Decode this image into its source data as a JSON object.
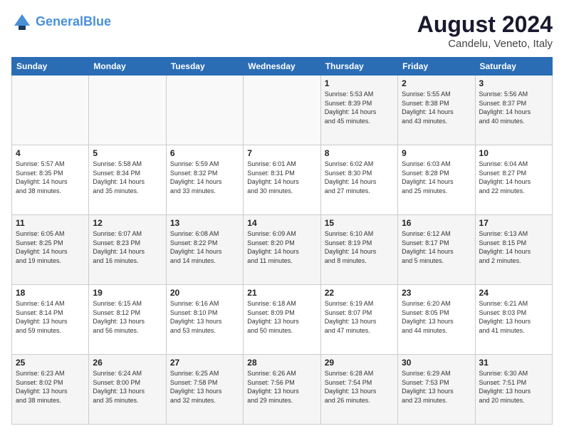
{
  "header": {
    "logo_line1": "General",
    "logo_line2": "Blue",
    "month_year": "August 2024",
    "location": "Candelu, Veneto, Italy"
  },
  "days_of_week": [
    "Sunday",
    "Monday",
    "Tuesday",
    "Wednesday",
    "Thursday",
    "Friday",
    "Saturday"
  ],
  "weeks": [
    [
      {
        "day": "",
        "info": ""
      },
      {
        "day": "",
        "info": ""
      },
      {
        "day": "",
        "info": ""
      },
      {
        "day": "",
        "info": ""
      },
      {
        "day": "1",
        "info": "Sunrise: 5:53 AM\nSunset: 8:39 PM\nDaylight: 14 hours\nand 45 minutes."
      },
      {
        "day": "2",
        "info": "Sunrise: 5:55 AM\nSunset: 8:38 PM\nDaylight: 14 hours\nand 43 minutes."
      },
      {
        "day": "3",
        "info": "Sunrise: 5:56 AM\nSunset: 8:37 PM\nDaylight: 14 hours\nand 40 minutes."
      }
    ],
    [
      {
        "day": "4",
        "info": "Sunrise: 5:57 AM\nSunset: 8:35 PM\nDaylight: 14 hours\nand 38 minutes."
      },
      {
        "day": "5",
        "info": "Sunrise: 5:58 AM\nSunset: 8:34 PM\nDaylight: 14 hours\nand 35 minutes."
      },
      {
        "day": "6",
        "info": "Sunrise: 5:59 AM\nSunset: 8:32 PM\nDaylight: 14 hours\nand 33 minutes."
      },
      {
        "day": "7",
        "info": "Sunrise: 6:01 AM\nSunset: 8:31 PM\nDaylight: 14 hours\nand 30 minutes."
      },
      {
        "day": "8",
        "info": "Sunrise: 6:02 AM\nSunset: 8:30 PM\nDaylight: 14 hours\nand 27 minutes."
      },
      {
        "day": "9",
        "info": "Sunrise: 6:03 AM\nSunset: 8:28 PM\nDaylight: 14 hours\nand 25 minutes."
      },
      {
        "day": "10",
        "info": "Sunrise: 6:04 AM\nSunset: 8:27 PM\nDaylight: 14 hours\nand 22 minutes."
      }
    ],
    [
      {
        "day": "11",
        "info": "Sunrise: 6:05 AM\nSunset: 8:25 PM\nDaylight: 14 hours\nand 19 minutes."
      },
      {
        "day": "12",
        "info": "Sunrise: 6:07 AM\nSunset: 8:23 PM\nDaylight: 14 hours\nand 16 minutes."
      },
      {
        "day": "13",
        "info": "Sunrise: 6:08 AM\nSunset: 8:22 PM\nDaylight: 14 hours\nand 14 minutes."
      },
      {
        "day": "14",
        "info": "Sunrise: 6:09 AM\nSunset: 8:20 PM\nDaylight: 14 hours\nand 11 minutes."
      },
      {
        "day": "15",
        "info": "Sunrise: 6:10 AM\nSunset: 8:19 PM\nDaylight: 14 hours\nand 8 minutes."
      },
      {
        "day": "16",
        "info": "Sunrise: 6:12 AM\nSunset: 8:17 PM\nDaylight: 14 hours\nand 5 minutes."
      },
      {
        "day": "17",
        "info": "Sunrise: 6:13 AM\nSunset: 8:15 PM\nDaylight: 14 hours\nand 2 minutes."
      }
    ],
    [
      {
        "day": "18",
        "info": "Sunrise: 6:14 AM\nSunset: 8:14 PM\nDaylight: 13 hours\nand 59 minutes."
      },
      {
        "day": "19",
        "info": "Sunrise: 6:15 AM\nSunset: 8:12 PM\nDaylight: 13 hours\nand 56 minutes."
      },
      {
        "day": "20",
        "info": "Sunrise: 6:16 AM\nSunset: 8:10 PM\nDaylight: 13 hours\nand 53 minutes."
      },
      {
        "day": "21",
        "info": "Sunrise: 6:18 AM\nSunset: 8:09 PM\nDaylight: 13 hours\nand 50 minutes."
      },
      {
        "day": "22",
        "info": "Sunrise: 6:19 AM\nSunset: 8:07 PM\nDaylight: 13 hours\nand 47 minutes."
      },
      {
        "day": "23",
        "info": "Sunrise: 6:20 AM\nSunset: 8:05 PM\nDaylight: 13 hours\nand 44 minutes."
      },
      {
        "day": "24",
        "info": "Sunrise: 6:21 AM\nSunset: 8:03 PM\nDaylight: 13 hours\nand 41 minutes."
      }
    ],
    [
      {
        "day": "25",
        "info": "Sunrise: 6:23 AM\nSunset: 8:02 PM\nDaylight: 13 hours\nand 38 minutes."
      },
      {
        "day": "26",
        "info": "Sunrise: 6:24 AM\nSunset: 8:00 PM\nDaylight: 13 hours\nand 35 minutes."
      },
      {
        "day": "27",
        "info": "Sunrise: 6:25 AM\nSunset: 7:58 PM\nDaylight: 13 hours\nand 32 minutes."
      },
      {
        "day": "28",
        "info": "Sunrise: 6:26 AM\nSunset: 7:56 PM\nDaylight: 13 hours\nand 29 minutes."
      },
      {
        "day": "29",
        "info": "Sunrise: 6:28 AM\nSunset: 7:54 PM\nDaylight: 13 hours\nand 26 minutes."
      },
      {
        "day": "30",
        "info": "Sunrise: 6:29 AM\nSunset: 7:53 PM\nDaylight: 13 hours\nand 23 minutes."
      },
      {
        "day": "31",
        "info": "Sunrise: 6:30 AM\nSunset: 7:51 PM\nDaylight: 13 hours\nand 20 minutes."
      }
    ]
  ]
}
